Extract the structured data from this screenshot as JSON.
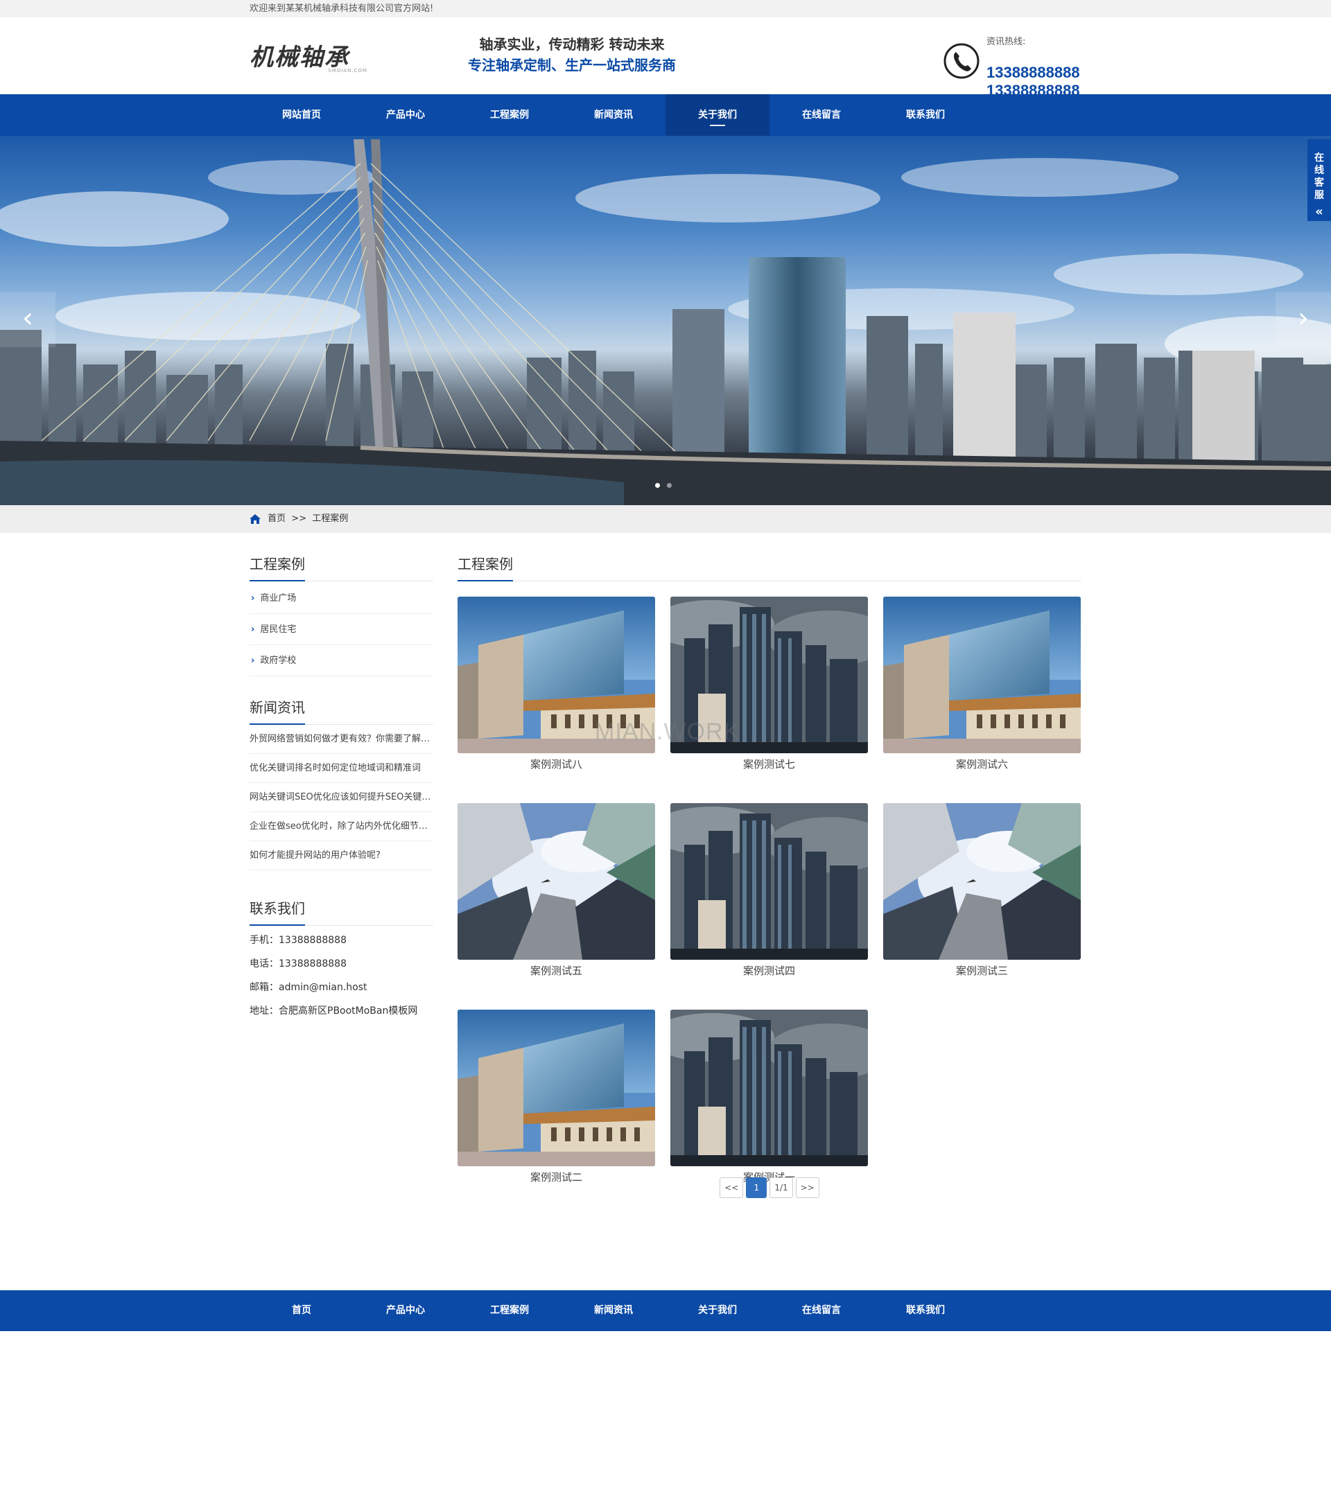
{
  "topbar": {
    "welcome": "欢迎来到某某机械轴承科技有限公司官方网站!"
  },
  "header": {
    "logo_text": "机械轴承",
    "logo_sub": "SMOIAN.COM",
    "slogan_line1": "轴承实业，传动精彩 转动未来",
    "slogan_line2": "专注轴承定制、生产一站式服务商",
    "hotline_label": "资讯热线:",
    "hotline_1": "13388888888",
    "hotline_2": "13388888888"
  },
  "nav": {
    "items": [
      {
        "label": "网站首页"
      },
      {
        "label": "产品中心"
      },
      {
        "label": "工程案例"
      },
      {
        "label": "新闻资讯"
      },
      {
        "label": "关于我们"
      },
      {
        "label": "在线留言"
      },
      {
        "label": "联系我们"
      }
    ],
    "active_index": 4
  },
  "banner": {
    "prev": "‹",
    "next": "›",
    "service_tab": "在线客服",
    "service_arrow": "«",
    "slides_count": 2,
    "active_slide": 0
  },
  "breadcrumb": {
    "home": "首页",
    "sep": ">>",
    "current": "工程案例"
  },
  "sidebar": {
    "categories_title": "工程案例",
    "categories": [
      "商业广场",
      "居民住宅",
      "政府学校"
    ],
    "news_title": "新闻资讯",
    "news": [
      "外贸网络营销如何做才更有效？你需要了解这些",
      "优化关键词排名时如何定位地域词和精准词",
      "网站关键词SEO优化应该如何提升SEO关键词排名",
      "企业在做seo优化时，除了站内外优化细节还要注意",
      "如何才能提升网站的用户体验呢?"
    ],
    "contact_title": "联系我们",
    "contact": [
      "手机：13388888888",
      "电话：13388888888",
      "邮箱：admin@mian.host",
      "地址：合肥高新区PBootMoBan模板网"
    ]
  },
  "content": {
    "title": "工程案例",
    "watermark": "MIAN.WORK",
    "cases": [
      {
        "caption": "案例测试八",
        "image": "building-modern-a"
      },
      {
        "caption": "案例测试七",
        "image": "skyscrapers-cloudy"
      },
      {
        "caption": "案例测试六",
        "image": "building-modern-a"
      },
      {
        "caption": "案例测试五",
        "image": "skyscrapers-lookup"
      },
      {
        "caption": "案例测试四",
        "image": "skyscrapers-cloudy"
      },
      {
        "caption": "案例测试三",
        "image": "skyscrapers-lookup"
      },
      {
        "caption": "案例测试二",
        "image": "building-modern-a"
      },
      {
        "caption": "案例测试一",
        "image": "skyscrapers-cloudy"
      }
    ],
    "pager": {
      "first": "<<",
      "current": "1",
      "info": "1/1",
      "last": ">>"
    }
  },
  "footer_nav": [
    "首页",
    "产品中心",
    "工程案例",
    "新闻资讯",
    "关于我们",
    "在线留言",
    "联系我们"
  ],
  "colors": {
    "brand": "#0b4aa6",
    "nav_active": "#083c8a",
    "pager_active": "#2f6fbf"
  }
}
